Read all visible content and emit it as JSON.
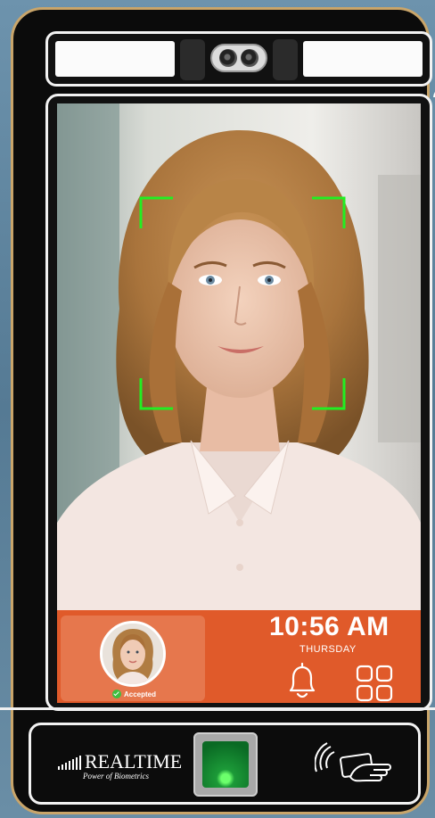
{
  "screen": {
    "time": "10:56 AM",
    "day": "THURSDAY",
    "status": "Accepted"
  },
  "brand": {
    "name": "REALTIME",
    "tagline": "Power of Biometrics"
  },
  "icons": {
    "wifi": "wifi-icon",
    "notifications": "bell-icon",
    "apps": "apps-grid-icon",
    "card_reader": "card-tap-icon",
    "fingerprint": "fingerprint-sensor",
    "check": "check-icon"
  },
  "colors": {
    "accent": "#e05a2a",
    "face_frame": "#22ee22",
    "device_bezel": "#0b0b0b",
    "device_trim": "#c9a56a"
  }
}
